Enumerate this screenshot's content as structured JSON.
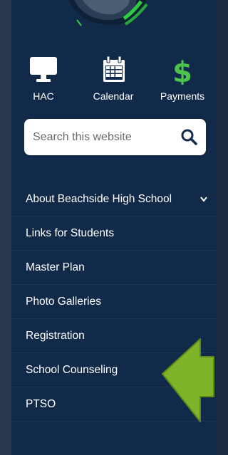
{
  "colors": {
    "page_bg": "#1b2c41",
    "panel_bg": "#122a49",
    "accent_green": "#4cc34a",
    "arrow_green": "#7fb32a"
  },
  "quick_links": [
    {
      "label": "HAC",
      "icon": "monitor-icon"
    },
    {
      "label": "Calendar",
      "icon": "calendar-icon"
    },
    {
      "label": "Payments",
      "icon": "dollar-icon"
    }
  ],
  "search": {
    "placeholder": "Search this website",
    "icon": "search-icon"
  },
  "nav": {
    "items": [
      {
        "label": "About Beachside High School",
        "has_submenu": true
      },
      {
        "label": "Links for Students"
      },
      {
        "label": "Master Plan"
      },
      {
        "label": "Photo Galleries"
      },
      {
        "label": "Registration"
      },
      {
        "label": "School Counseling",
        "highlighted_by": "arrow-pointer"
      },
      {
        "label": "PTSO"
      }
    ]
  }
}
